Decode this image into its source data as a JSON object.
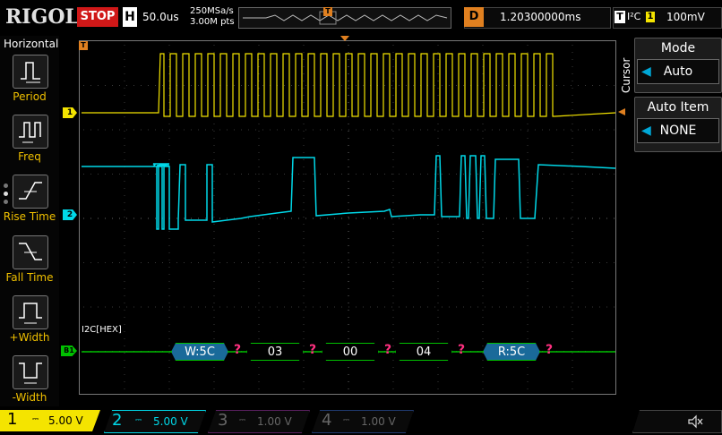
{
  "top": {
    "brand": "RIGOL",
    "run_state": "STOP",
    "timebase_label": "H",
    "timebase_value": "50.0us",
    "sample_rate": "250MSa/s",
    "memory_depth": "3.00M pts",
    "delay_label": "D",
    "delay_value": "1.20300000ms",
    "trigger_label": "T",
    "trigger_mode": "I²C",
    "trigger_channel": "1",
    "trigger_level": "100mV"
  },
  "left_menu": {
    "title": "Horizontal",
    "items": [
      {
        "label": "Period",
        "icon": "period-icon"
      },
      {
        "label": "Freq",
        "icon": "frequency-icon"
      },
      {
        "label": "Rise Time",
        "icon": "rise-time-icon"
      },
      {
        "label": "Fall Time",
        "icon": "fall-time-icon"
      },
      {
        "label": "+Width",
        "icon": "positive-width-icon"
      },
      {
        "label": "-Width",
        "icon": "negative-width-icon"
      }
    ]
  },
  "right_menu": {
    "side_label": "Cursor",
    "mode_title": "Mode",
    "mode_value": "Auto",
    "item_title": "Auto Item",
    "item_value": "NONE"
  },
  "decode": {
    "label": "I2C[HEX]",
    "bus_marker": "B1",
    "packets": [
      "W:5C",
      "03",
      "00",
      "04",
      "R:5C"
    ],
    "ack_symbol": "?"
  },
  "channel_markers": {
    "ch1": "1",
    "ch2": "2",
    "trigger_pos": "T"
  },
  "channels": [
    {
      "num": "1",
      "scale": "5.00 V",
      "color": "#f4e400",
      "active": true
    },
    {
      "num": "2",
      "scale": "5.00 V",
      "color": "#00d8e8",
      "active": true
    },
    {
      "num": "3",
      "scale": "1.00 V",
      "color": "#d040c0",
      "active": false
    },
    {
      "num": "4",
      "scale": "1.00 V",
      "color": "#2070e0",
      "active": false
    }
  ],
  "colors": {
    "ch1": "#f4e400",
    "ch2": "#00d8e8",
    "bus": "#00c000",
    "packet_data": "#00a020",
    "packet_addr": "#1a6a9a",
    "stop": "#d01818",
    "delay": "#e08020",
    "menu_label": "#f0c000"
  }
}
